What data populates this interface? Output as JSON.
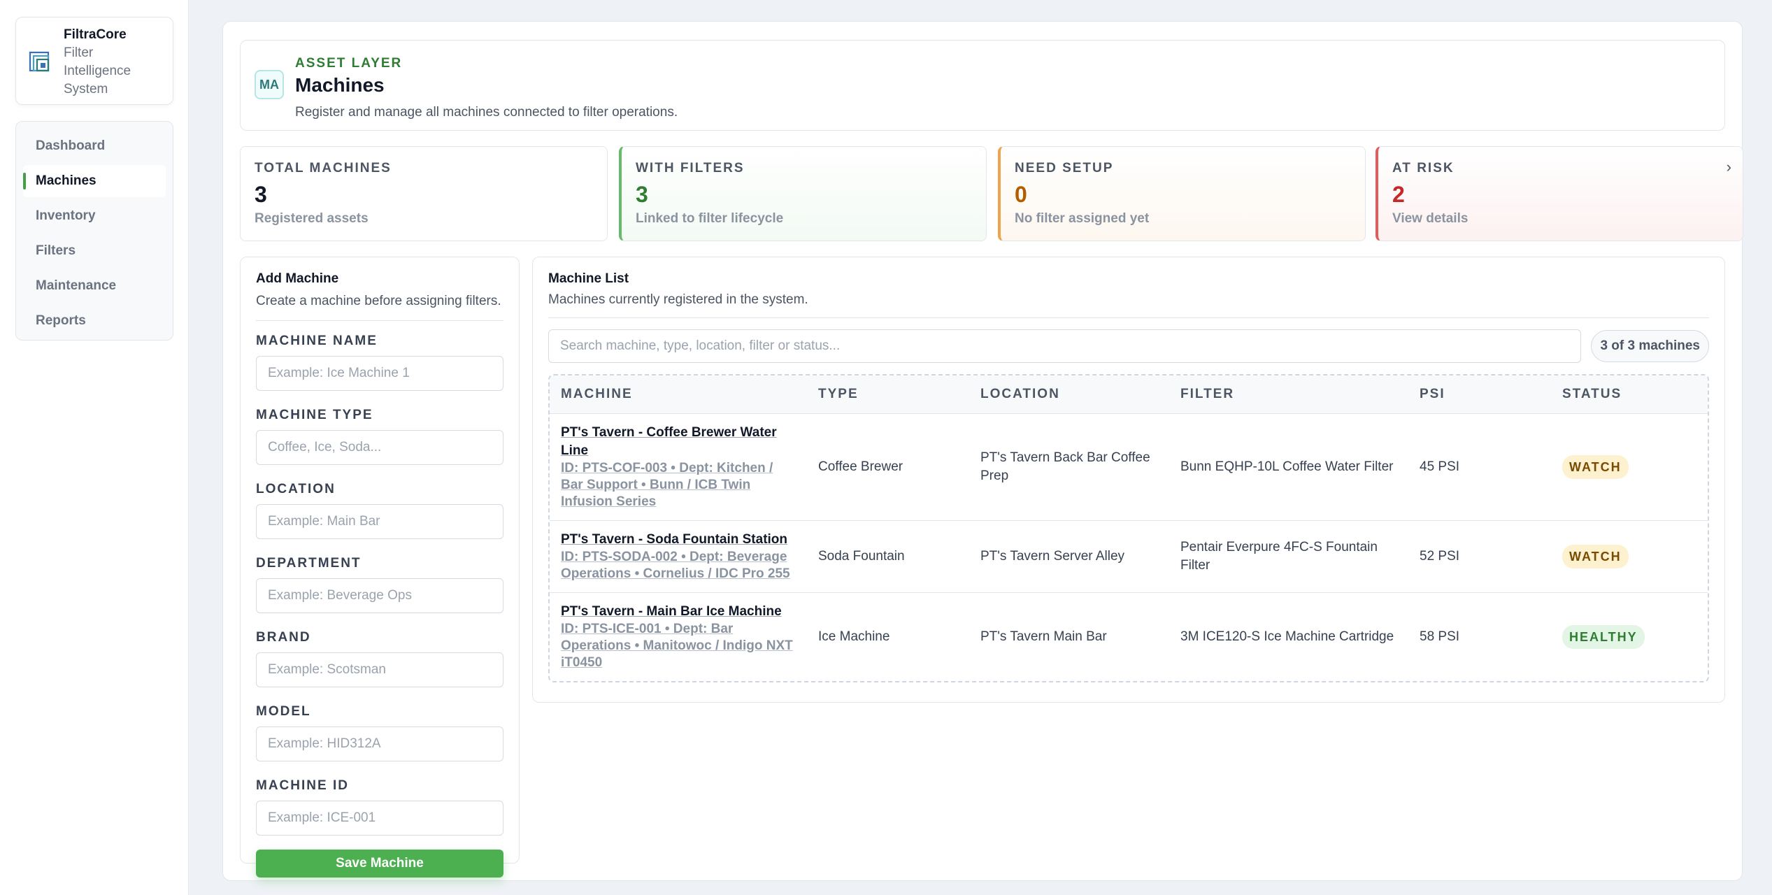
{
  "brand": {
    "name": "FiltraCore",
    "subtitle_lines": [
      "Filter",
      "Intelligence",
      "System"
    ]
  },
  "nav": {
    "items": [
      {
        "label": "Dashboard",
        "active": false
      },
      {
        "label": "Machines",
        "active": true
      },
      {
        "label": "Inventory",
        "active": false
      },
      {
        "label": "Filters",
        "active": false
      },
      {
        "label": "Maintenance",
        "active": false
      },
      {
        "label": "Reports",
        "active": false
      }
    ]
  },
  "header": {
    "badge": "MA",
    "kicker": "ASSET LAYER",
    "title": "Machines",
    "description": "Register and manage all machines connected to filter operations."
  },
  "stats": [
    {
      "label": "TOTAL MACHINES",
      "value": "3",
      "note": "Registered assets",
      "color": "#111827"
    },
    {
      "label": "WITH FILTERS",
      "value": "3",
      "note": "Linked to filter lifecycle",
      "color": "#2e7d32"
    },
    {
      "label": "NEED SETUP",
      "value": "0",
      "note": "No filter assigned yet",
      "color": "#b35c00"
    },
    {
      "label": "AT RISK",
      "value": "2",
      "note": "View details",
      "color": "#c62828"
    }
  ],
  "form": {
    "title": "Add Machine",
    "description": "Create a machine before assigning filters.",
    "fields": [
      {
        "label": "MACHINE NAME",
        "placeholder": "Example: Ice Machine 1"
      },
      {
        "label": "MACHINE TYPE",
        "placeholder": "Coffee, Ice, Soda..."
      },
      {
        "label": "LOCATION",
        "placeholder": "Example: Main Bar"
      },
      {
        "label": "DEPARTMENT",
        "placeholder": "Example: Beverage Ops"
      },
      {
        "label": "BRAND",
        "placeholder": "Example: Scotsman"
      },
      {
        "label": "MODEL",
        "placeholder": "Example: HID312A"
      },
      {
        "label": "MACHINE ID",
        "placeholder": "Example: ICE-001"
      }
    ],
    "save_label": "Save Machine"
  },
  "list": {
    "title": "Machine List",
    "description": "Machines currently registered in the system.",
    "search_placeholder": "Search machine, type, location, filter or status...",
    "count": "3 of 3 machines",
    "columns": [
      "MACHINE",
      "TYPE",
      "LOCATION",
      "FILTER",
      "PSI",
      "STATUS"
    ],
    "rows": [
      {
        "name": "PT's Tavern - Coffee Brewer Water Line",
        "meta": "ID: PTS-COF-003 • Dept: Kitchen / Bar Support • Bunn / ICB Twin Infusion Series",
        "type": "Coffee Brewer",
        "location": "PT's Tavern Back Bar Coffee Prep",
        "filter": "Bunn EQHP-10L Coffee Water Filter",
        "psi": "45 PSI",
        "status": "WATCH"
      },
      {
        "name": "PT's Tavern - Soda Fountain Station",
        "meta": "ID: PTS-SODA-002 • Dept: Beverage Operations • Cornelius / IDC Pro 255",
        "type": "Soda Fountain",
        "location": "PT's Tavern Server Alley",
        "filter": "Pentair Everpure 4FC-S Fountain Filter",
        "psi": "52 PSI",
        "status": "WATCH"
      },
      {
        "name": "PT's Tavern - Main Bar Ice Machine",
        "meta": "ID: PTS-ICE-001 • Dept: Bar Operations • Manitowoc / Indigo NXT iT0450",
        "type": "Ice Machine",
        "location": "PT's Tavern Main Bar",
        "filter": "3M ICE120-S Ice Machine Cartridge",
        "psi": "58 PSI",
        "status": "HEALTHY"
      }
    ]
  }
}
